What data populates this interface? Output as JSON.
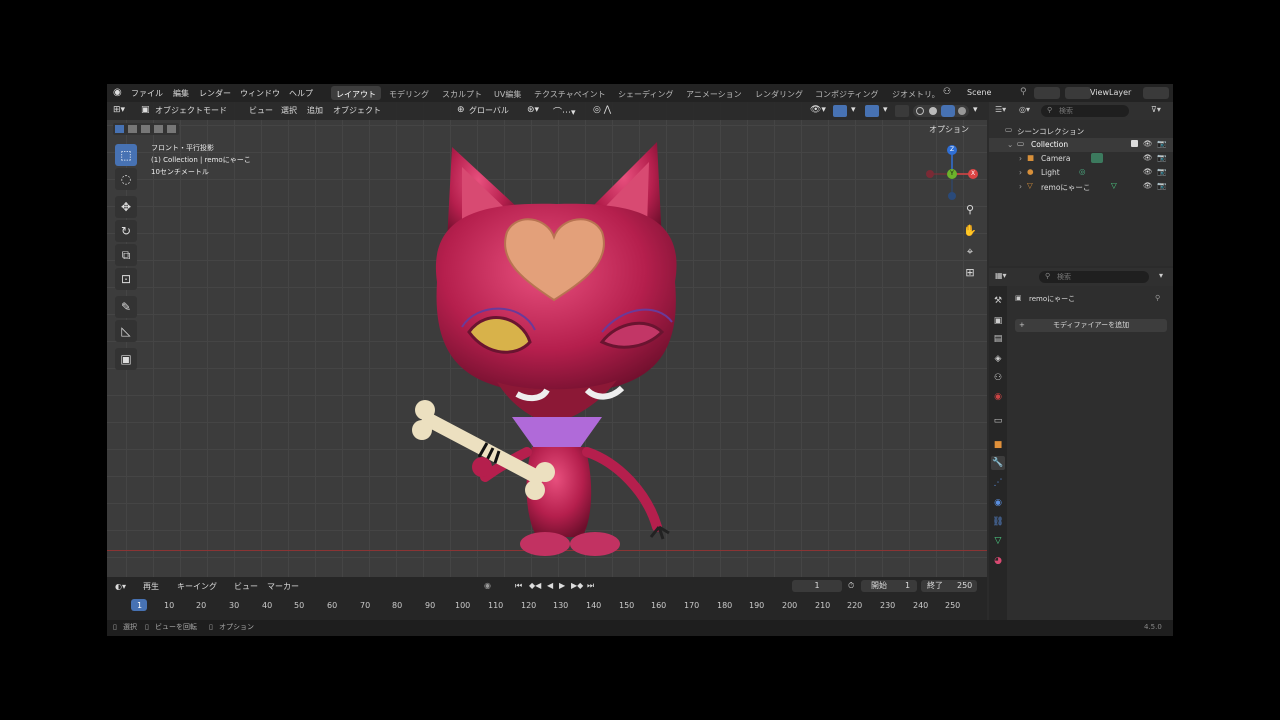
{
  "menubar": {
    "items": [
      "ファイル",
      "編集",
      "レンダー",
      "ウィンドウ",
      "ヘルプ"
    ],
    "workspaces": [
      "レイアウト",
      "モデリング",
      "スカルプト",
      "UV編集",
      "テクスチャペイント",
      "シェーディング",
      "アニメーション",
      "レンダリング",
      "コンポジティング",
      "ジオメトリ。"
    ],
    "active_workspace": "レイアウト",
    "scene": "Scene",
    "view_layer": "ViewLayer"
  },
  "viewport_header": {
    "mode": "オブジェクトモード",
    "menus": [
      "ビュー",
      "選択",
      "追加",
      "オブジェクト"
    ],
    "transform": "グローバル",
    "options": "オプション"
  },
  "viewport_info": {
    "view": "フロント・平行投影",
    "collection": "(1) Collection | remoにゃーこ",
    "scale": "10センチメートル"
  },
  "gizmo": {
    "z": "Z",
    "y": "Y",
    "x": "X"
  },
  "timeline": {
    "menus": [
      "再生",
      "キーイング",
      "ビュー",
      "マーカー"
    ],
    "current_frame": "1",
    "start_label": "開始",
    "start": "1",
    "end_label": "終了",
    "end": "250",
    "ticks": [
      "1",
      "10",
      "20",
      "30",
      "40",
      "50",
      "60",
      "70",
      "80",
      "90",
      "100",
      "110",
      "120",
      "130",
      "140",
      "150",
      "160",
      "170",
      "180",
      "190",
      "200",
      "210",
      "220",
      "230",
      "240",
      "250"
    ]
  },
  "statusbar": {
    "select": "選択",
    "rotate": "ビューを回転",
    "options": "オプション",
    "version": "4.5.0"
  },
  "outliner": {
    "search_placeholder": "検索",
    "scene_collection": "シーンコレクション",
    "collection": "Collection",
    "items": [
      "Camera",
      "Light",
      "remoにゃーこ"
    ]
  },
  "properties": {
    "search_placeholder": "検索",
    "object": "remoにゃーこ",
    "add_modifier": "モディファイアーを追加"
  },
  "colors": {
    "accent": "#4772b3",
    "model": "#c2285a",
    "heart": "#e3a07a"
  }
}
